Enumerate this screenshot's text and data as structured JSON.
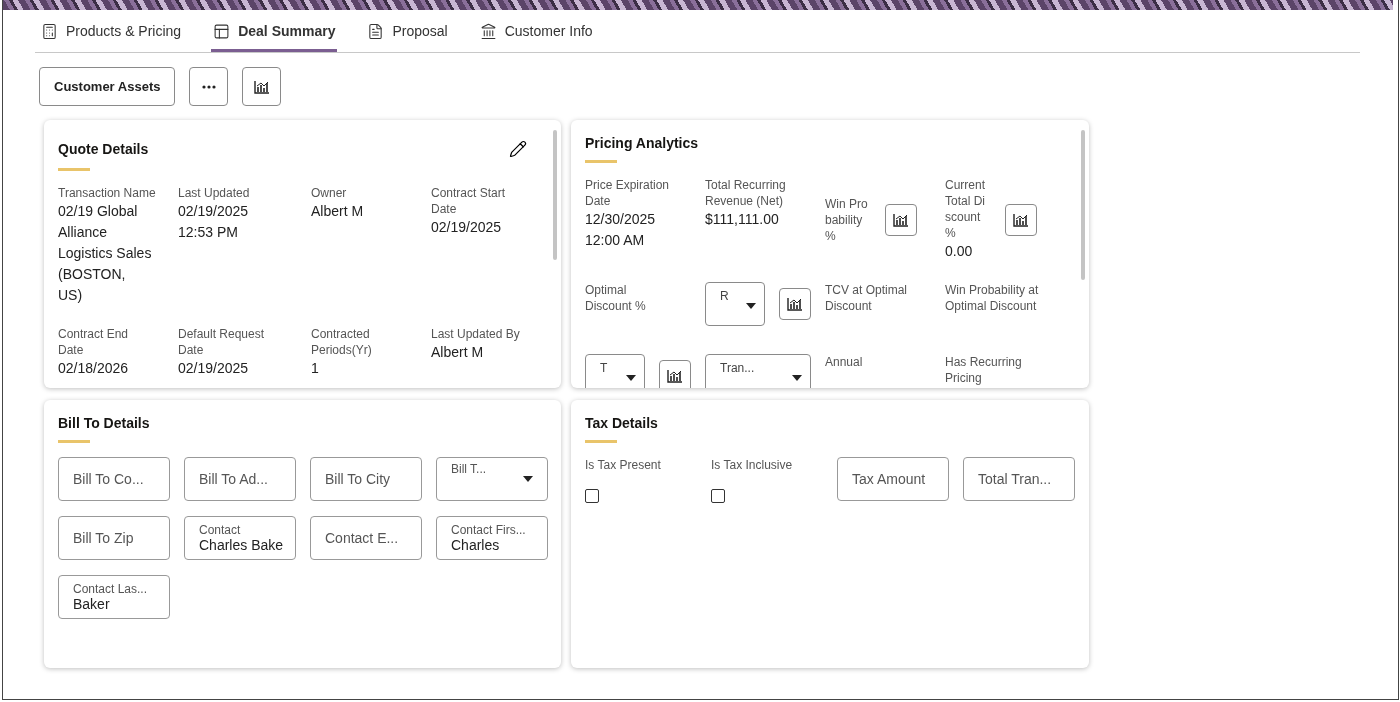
{
  "tabs": [
    {
      "label": "Products & Pricing",
      "selected": false
    },
    {
      "label": "Deal Summary",
      "selected": true
    },
    {
      "label": "Proposal",
      "selected": false
    },
    {
      "label": "Customer Info",
      "selected": false
    }
  ],
  "toolbar": [
    {
      "kind": "text",
      "label": "Customer Assets"
    },
    {
      "kind": "more"
    },
    {
      "kind": "chart"
    }
  ],
  "quote_details": {
    "title": "Quote Details",
    "fields": [
      {
        "label": "Transaction Name",
        "value": "02/19 Global Alliance Logistics Sales (BOSTON, US)"
      },
      {
        "label": "Last Updated",
        "value": "02/19/2025 12:53 PM"
      },
      {
        "label": "Owner",
        "value": "Albert M"
      },
      {
        "label": "Contract Start Date",
        "value": "02/19/2025"
      },
      {
        "label": "Contract End Date",
        "value": "02/18/2026"
      },
      {
        "label": "Default Request Date",
        "value": "02/19/2025"
      },
      {
        "label": "Contracted Periods(Yr)",
        "value": "1"
      },
      {
        "label": "Last Updated By",
        "value": "Albert M"
      }
    ]
  },
  "pricing_analytics": {
    "title": "Pricing Analytics",
    "rows": [
      [
        {
          "kind": "field",
          "label": "Price Expiration Date",
          "value": "12/30/2025 12:00 AM",
          "chart": false
        },
        {
          "kind": "field",
          "label": "Total Recurring Revenue (Net)",
          "value": "$111,111.00",
          "chart": false
        },
        {
          "kind": "field",
          "label": "Win Probability %",
          "chart": true
        },
        {
          "kind": "field",
          "label": "Current Total Discount %",
          "value": "0.00",
          "chart": true
        }
      ],
      [
        {
          "kind": "field",
          "label": "Optimal Discount %",
          "chart": false
        },
        {
          "kind": "select",
          "text": "R",
          "chart": true
        },
        {
          "kind": "field",
          "label": "TCV at Optimal Discount",
          "chart": false
        },
        {
          "kind": "field",
          "label": "Win Probability at Optimal Discount",
          "chart": false
        }
      ],
      [
        {
          "kind": "select",
          "text": "T",
          "chart": true
        },
        {
          "kind": "select",
          "text": "Tran...",
          "chart": false
        },
        {
          "kind": "field",
          "label": "Annual",
          "chart": false
        },
        {
          "kind": "field",
          "label": "Has Recurring Pricing",
          "chart": false
        }
      ]
    ]
  },
  "bill_to_details": {
    "title": "Bill To Details",
    "fields": [
      {
        "kind": "input",
        "placeholder": "Bill To Co..."
      },
      {
        "kind": "input",
        "placeholder": "Bill To Ad..."
      },
      {
        "kind": "input",
        "placeholder": "Bill To City"
      },
      {
        "kind": "select",
        "label": "Bill T..."
      },
      {
        "kind": "input",
        "placeholder": "Bill To Zip"
      },
      {
        "kind": "input",
        "label": "Contact",
        "value": "Charles Bake"
      },
      {
        "kind": "input",
        "placeholder": "Contact E..."
      },
      {
        "kind": "input",
        "label": "Contact Firs...",
        "value": "Charles"
      },
      {
        "kind": "input",
        "label": "Contact Las...",
        "value": "Baker"
      }
    ]
  },
  "tax_details": {
    "title": "Tax Details",
    "items": [
      {
        "kind": "checkbox",
        "label": "Is Tax Present",
        "checked": false
      },
      {
        "kind": "checkbox",
        "label": "Is Tax Inclusive",
        "checked": false
      },
      {
        "kind": "input",
        "placeholder": "Tax Amount"
      },
      {
        "kind": "input",
        "placeholder": "Total Tran..."
      }
    ]
  }
}
